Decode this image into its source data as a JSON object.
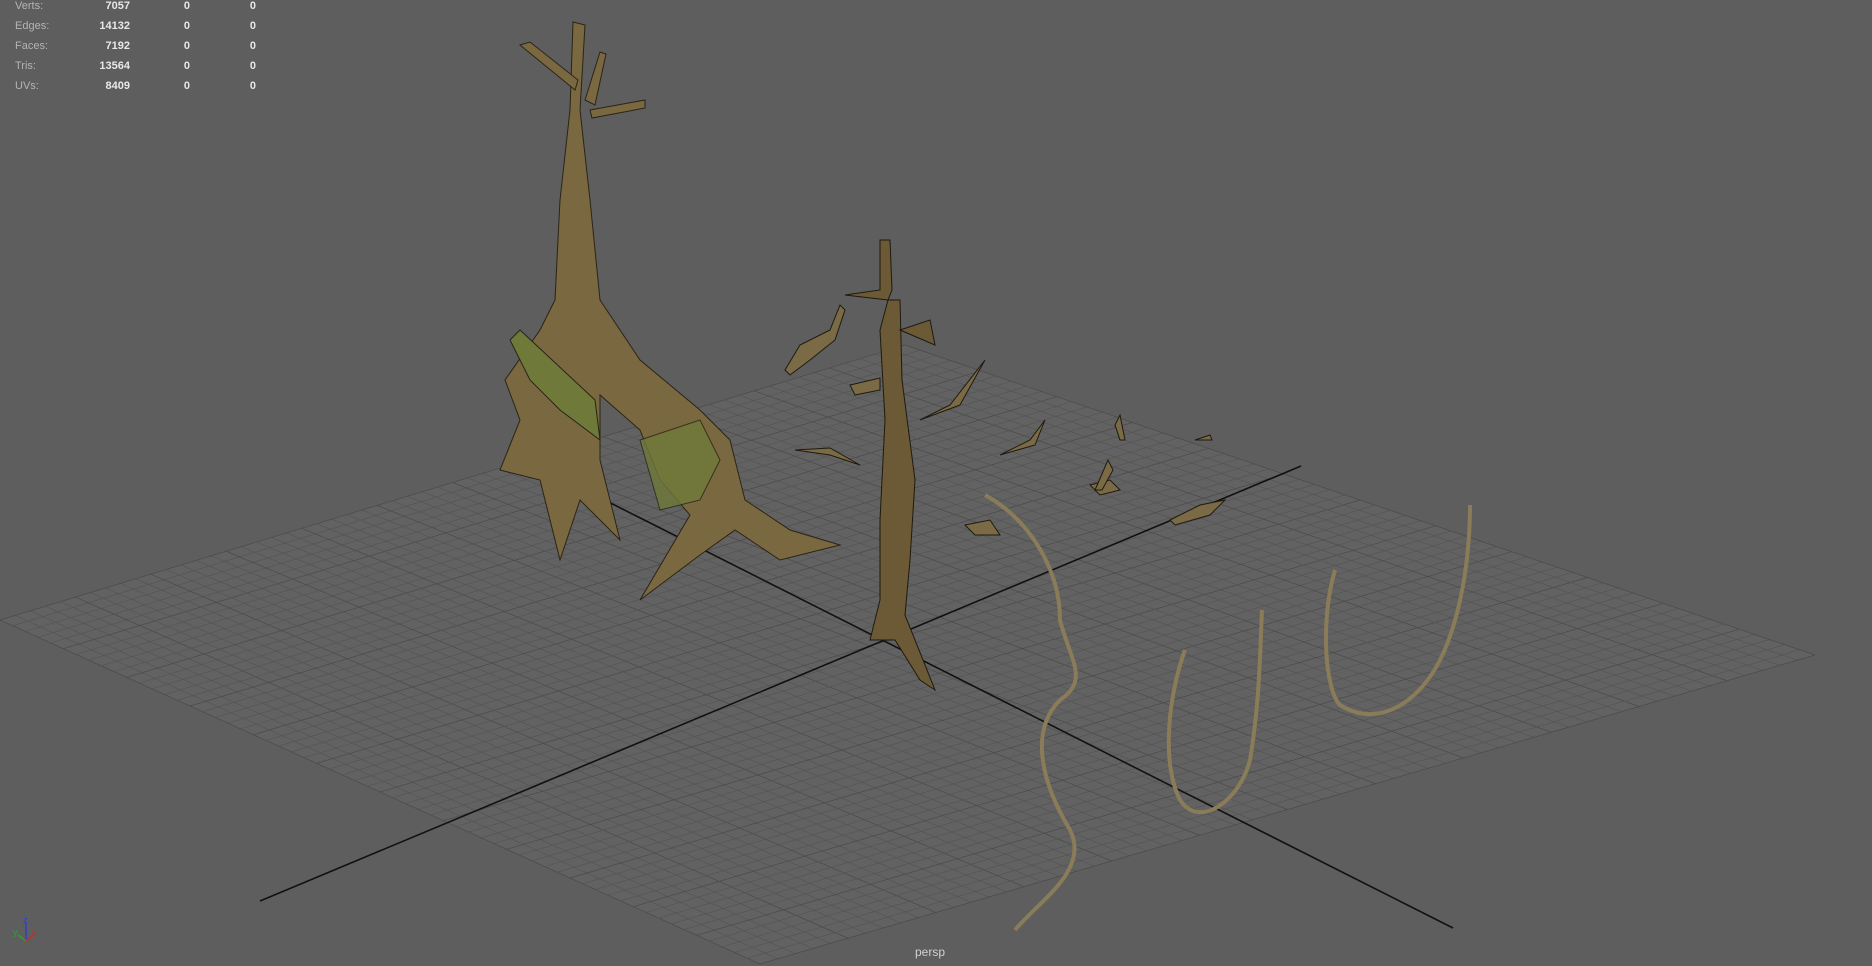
{
  "stats": [
    {
      "label": "Verts:",
      "values": [
        "7057",
        "0",
        "0"
      ]
    },
    {
      "label": "Edges:",
      "values": [
        "14132",
        "0",
        "0"
      ]
    },
    {
      "label": "Faces:",
      "values": [
        "7192",
        "0",
        "0"
      ]
    },
    {
      "label": "Tris:",
      "values": [
        "13564",
        "0",
        "0"
      ]
    },
    {
      "label": "UVs:",
      "values": [
        "8409",
        "0",
        "0"
      ]
    }
  ],
  "camera_label": "persp",
  "gizmo": {
    "z": "z",
    "y": "y",
    "x": "x"
  },
  "colors": {
    "background": "#5e5e5e",
    "grid": "#4e4e4e",
    "axis": "#111111",
    "bark": "#6b5a35",
    "moss": "#6f7a3a"
  }
}
